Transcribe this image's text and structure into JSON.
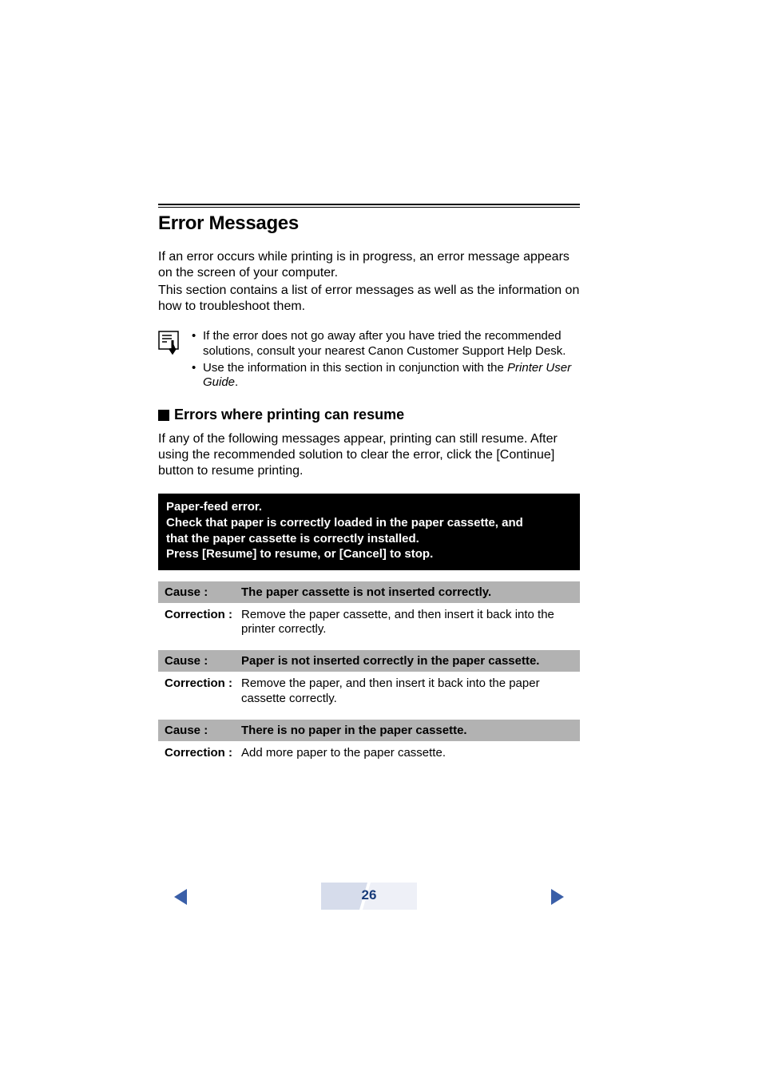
{
  "heading": "Error Messages",
  "intro1": "If an error occurs while printing is in progress, an error message appears on the screen of your computer.",
  "intro2": "This section contains a list of error messages as well as the information on how to troubleshoot them.",
  "notes": {
    "item1a": "If the error does not go away after you have tried the recommended solutions, consult your nearest Canon Customer Support Help Desk.",
    "item2a": "Use the information in this section in conjunction with the ",
    "item2b": "Printer User Guide",
    "item2c": "."
  },
  "sub": "Errors where printing can resume",
  "subintro": "If any of the following messages appear, printing can still resume. After using the recommended solution to clear the error, click the [Continue] button to resume printing.",
  "msgbox": {
    "title": "Paper-feed error.",
    "l1": "Check that paper is correctly loaded in the paper cassette, and",
    "l2": "that the paper cassette is correctly installed.",
    "l3": "Press [Resume] to resume, or [Cancel] to stop."
  },
  "labels": {
    "cause": "Cause :",
    "correction": "Correction :"
  },
  "c1": {
    "cause": "The paper cassette is not inserted correctly.",
    "corr": "Remove the paper cassette, and then insert it back into the printer correctly."
  },
  "c2": {
    "cause": "Paper is not inserted correctly in the paper cassette.",
    "corr": "Remove the paper, and then insert it back into the paper cassette correctly."
  },
  "c3": {
    "cause": "There is no paper in the paper cassette.",
    "corr": "Add more paper to the paper cassette."
  },
  "page": "26"
}
